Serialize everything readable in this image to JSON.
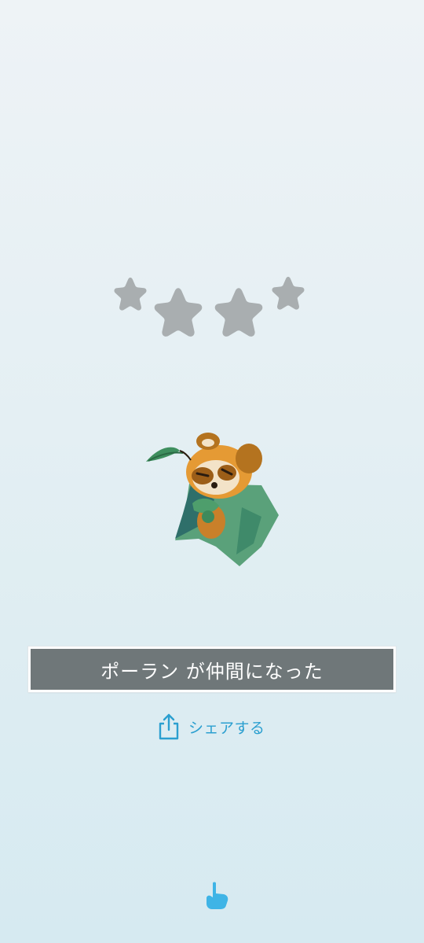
{
  "rating": {
    "stars_total": 4,
    "star_color": "#a9aeb0"
  },
  "character": {
    "icon": "tanuki-leaf-cloak-character"
  },
  "banner": {
    "message": "ポーラン が仲間になった",
    "bg_color": "#6f7779",
    "text_color": "#ffffff"
  },
  "share": {
    "icon": "share-icon",
    "label": "シェアする",
    "color": "#2b9fd0"
  },
  "tap_hint": {
    "icon": "pointing-hand-icon",
    "color": "#3fb4e6"
  }
}
